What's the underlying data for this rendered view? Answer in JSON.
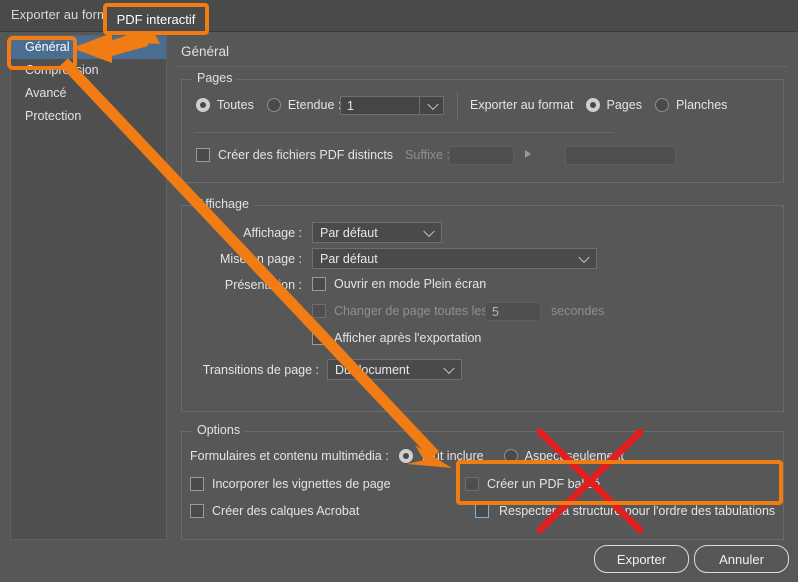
{
  "window": {
    "title": "Exporter au format"
  },
  "sidebar": {
    "items": [
      {
        "label": "Général",
        "selected": true
      },
      {
        "label": "Compression",
        "selected": false
      },
      {
        "label": "Avancé",
        "selected": false
      },
      {
        "label": "Protection",
        "selected": false
      }
    ]
  },
  "page": {
    "title": "Général"
  },
  "pages_group": {
    "legend": "Pages",
    "radio_toutes": "Toutes",
    "radio_etendue": "Etendue :",
    "etendue_value": "1",
    "export_format_label": "Exporter au format",
    "radio_pages": "Pages",
    "radio_planches": "Planches",
    "checkbox_distincts": "Créer des fichiers PDF distincts",
    "suffixe_label": "Suffixe :",
    "suffixe_value": "",
    "suffixe_extra_value": ""
  },
  "affichage_group": {
    "legend": "Affichage",
    "affichage_label": "Affichage :",
    "affichage_value": "Par défaut",
    "mise_en_page_label": "Mise en page :",
    "mise_en_page_value": "Par défaut",
    "presentation_label": "Présentation :",
    "checkbox_plein_ecran": "Ouvrir en mode Plein écran",
    "checkbox_changer_page": "Changer de page toutes les :",
    "secondes_value": "5",
    "secondes_label": "secondes",
    "checkbox_afficher_apres": "Afficher après l'exportation",
    "transitions_label": "Transitions de page :",
    "transitions_value": "Du document"
  },
  "options_group": {
    "legend": "Options",
    "formulaires_label": "Formulaires et contenu multimédia :",
    "radio_tout_inclure": "Tout inclure",
    "radio_aspect_seulement": "Aspect seulement",
    "checkbox_vignettes": "Incorporer les vignettes de page",
    "checkbox_calques": "Créer des calques Acrobat",
    "checkbox_pdf_balise": "Créer un PDF balisé",
    "checkbox_respecter_structure": "Respecter la structure pour l'ordre des tabulations"
  },
  "footer": {
    "export_label": "Exporter",
    "cancel_label": "Annuler"
  },
  "annotations": {
    "callout_label": "PDF interactif",
    "highlight_color": "#f07c13",
    "strike_color": "#e02020"
  },
  "colors": {
    "dialog_bg": "#575757",
    "titlebar_bg": "#4a4a4a",
    "selection_blue": "#4a6e91",
    "text": "#e4e4e4"
  }
}
